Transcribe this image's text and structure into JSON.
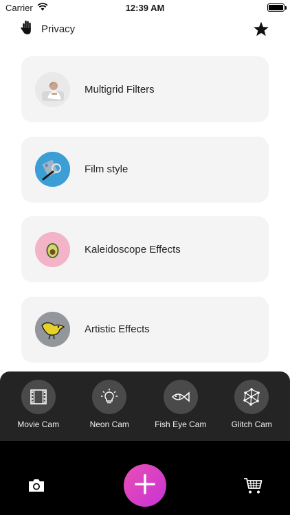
{
  "status_bar": {
    "carrier": "Carrier",
    "time": "12:39 AM"
  },
  "header": {
    "privacy_label": "Privacy",
    "privacy_icon": "hand-icon",
    "favorite_icon": "star-icon"
  },
  "cards": [
    {
      "title": "Multigrid Filters",
      "thumb": "woman-photo"
    },
    {
      "title": "Film style",
      "thumb": "magnifier-photo"
    },
    {
      "title": "Kaleidoscope Effects",
      "thumb": "avocado-photo"
    },
    {
      "title": "Artistic Effects",
      "thumb": "bird-drawing"
    }
  ],
  "cam_modes": [
    {
      "label": "Movie Cam",
      "icon": "film-icon"
    },
    {
      "label": "Neon Cam",
      "icon": "lightbulb-icon"
    },
    {
      "label": "Fish Eye Cam",
      "icon": "fish-icon"
    },
    {
      "label": "Glitch Cam",
      "icon": "network-icon"
    }
  ],
  "bottom_bar": {
    "camera_icon": "camera-icon",
    "add_icon": "plus-icon",
    "cart_icon": "cart-icon"
  },
  "colors": {
    "accent_start": "#e94fb4",
    "accent_end": "#c832d6",
    "panel_bg": "#242424",
    "card_bg": "#f4f4f5"
  }
}
